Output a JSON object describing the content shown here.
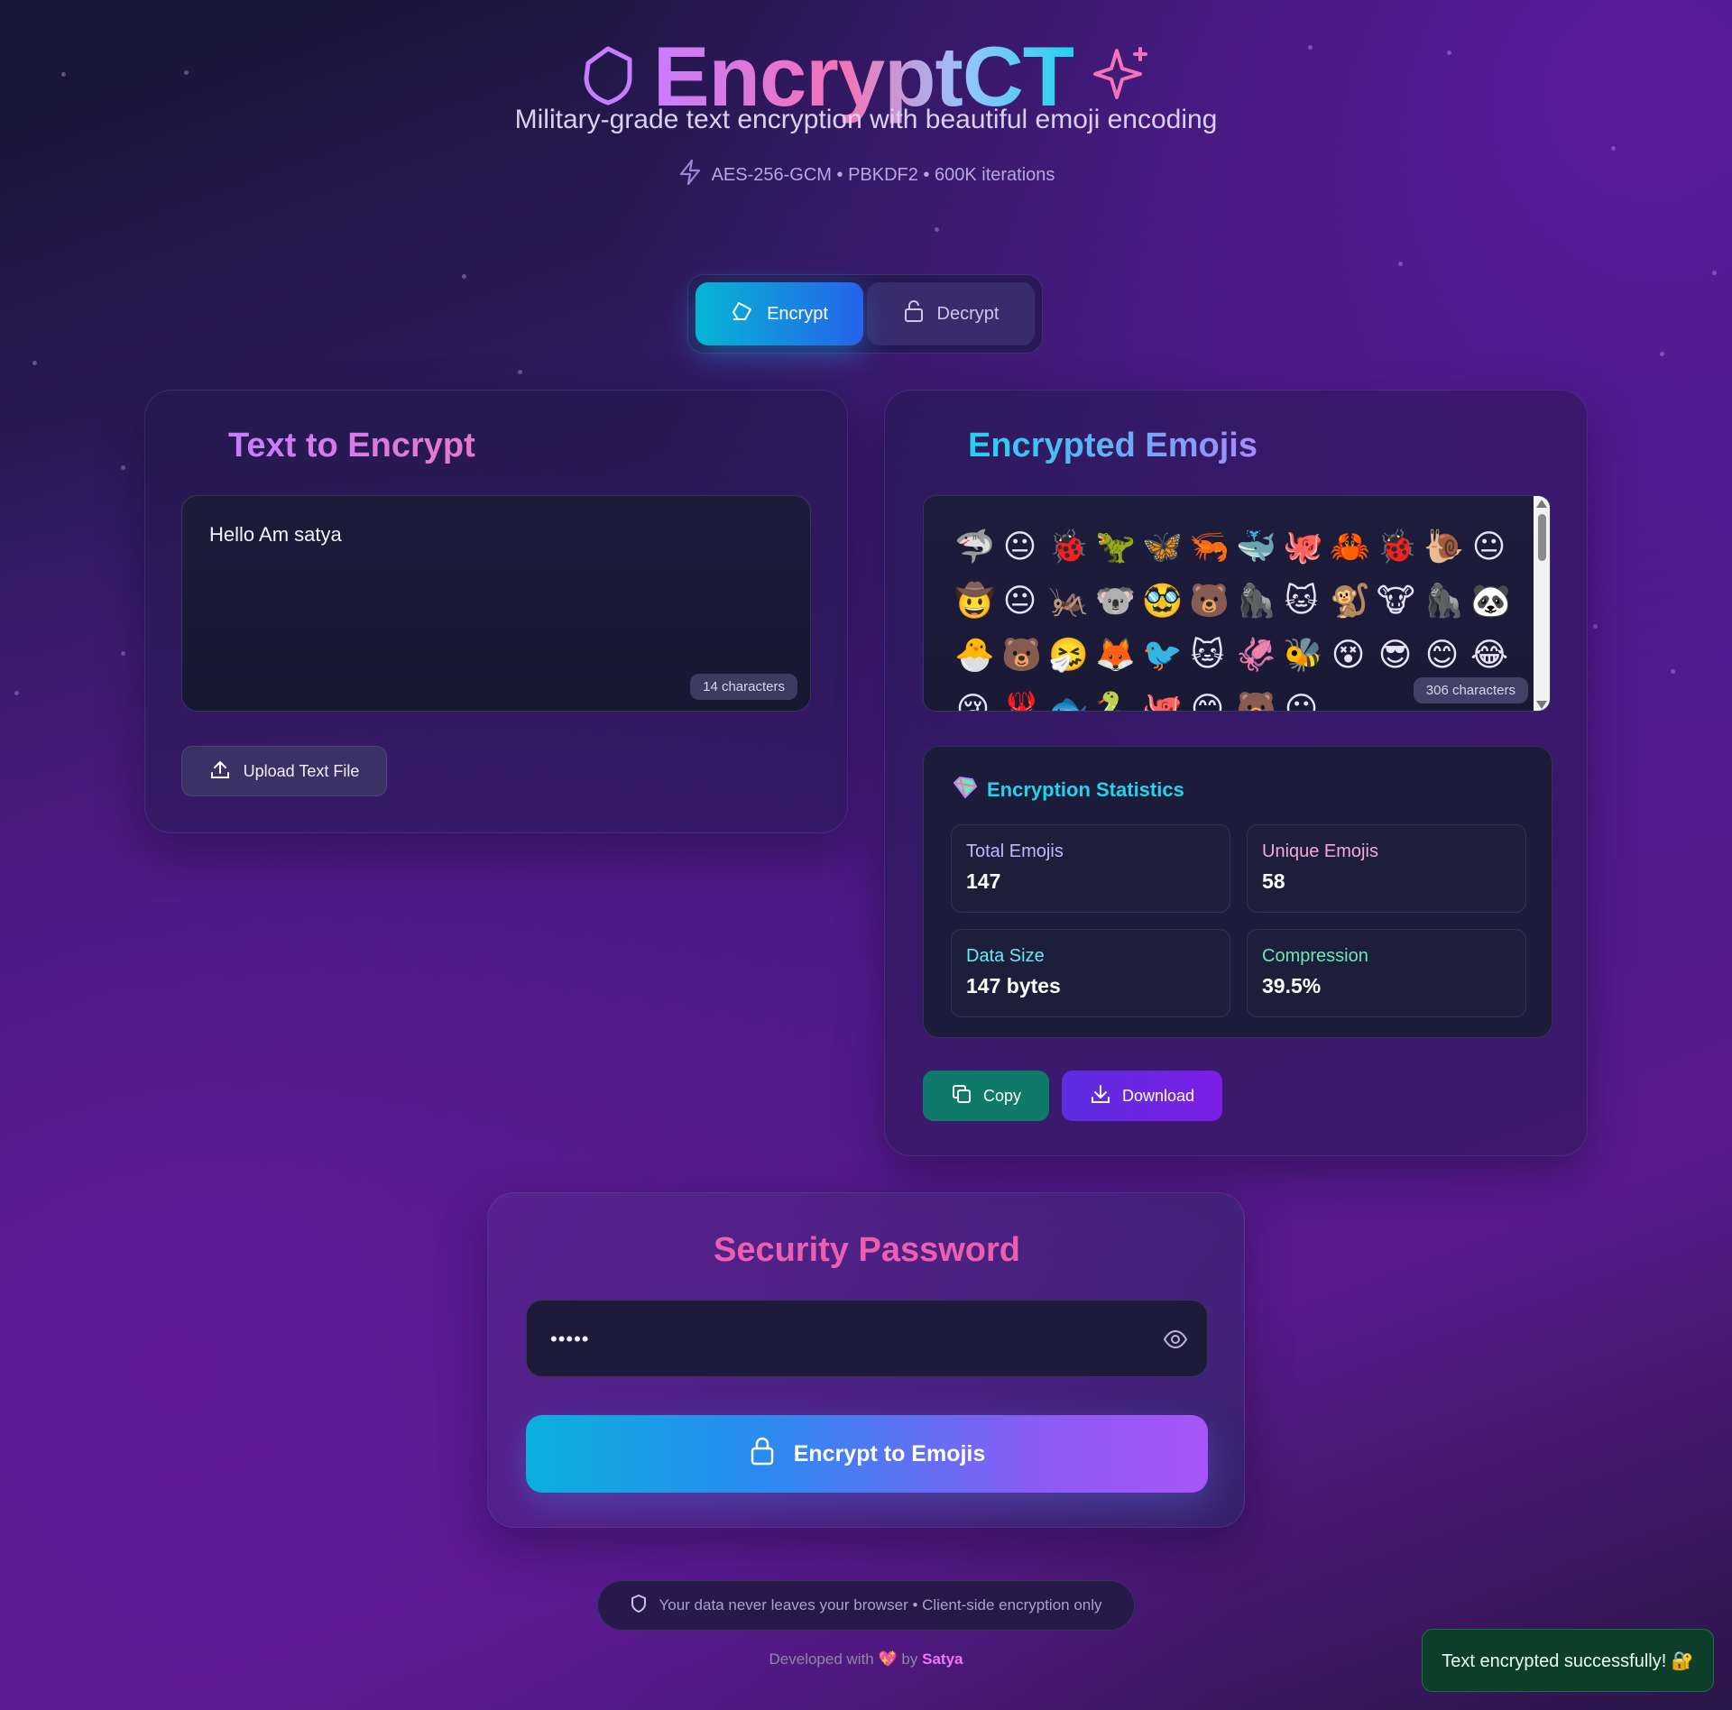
{
  "header": {
    "logo_icon": "shield-outline-icon",
    "title": "EncryptCT",
    "sparkle_icon": "sparkles-icon",
    "subtitle": "Military-grade text encryption with beautiful emoji encoding",
    "specs": "AES-256-GCM • PBKDF2 • 600K iterations",
    "specs_icon": "lightning-icon"
  },
  "mode_toggle": {
    "encrypt_label": "Encrypt",
    "decrypt_label": "Decrypt",
    "active": "Encrypt"
  },
  "input_panel": {
    "title": "Text to Encrypt",
    "text": "Hello Am satya",
    "char_count": "14 characters",
    "upload_label": "Upload Text File"
  },
  "output_panel": {
    "title": "Encrypted Emojis",
    "emojis": [
      "🦈",
      "😐",
      "🐞",
      "🦖",
      "🦋",
      "🦐",
      "🐳",
      "🐙",
      "🦀",
      "🐞",
      "🐌",
      "😐",
      "🤠",
      "😐",
      "🦗",
      "🐨",
      "🥸",
      "🐻",
      "🦍",
      "🐱",
      "🐒",
      "🐮",
      "🦍",
      "🐼",
      "🐣",
      "🐻",
      "🤧",
      "🦊",
      "🐦",
      "🐱",
      "🦑",
      "🐝",
      "😵",
      "😎",
      "😊",
      "😂",
      "😢",
      "🦞",
      "🐟",
      "🐍",
      "🐙",
      "😊",
      "🐻",
      "😐"
    ],
    "char_count": "306 characters",
    "stats": {
      "title": "Encryption Statistics",
      "total_label": "Total Emojis",
      "total_value": "147",
      "unique_label": "Unique Emojis",
      "unique_value": "58",
      "size_label": "Data Size",
      "size_value": "147 bytes",
      "compression_label": "Compression",
      "compression_value": "39.5%"
    },
    "copy_label": "Copy",
    "download_label": "Download"
  },
  "password": {
    "title": "Security Password",
    "value": "•••••",
    "encrypt_button": "Encrypt to Emojis"
  },
  "footer": {
    "privacy_note": "Your data never leaves your browser • Client-side encryption only",
    "credit_prefix": "Developed with",
    "credit_heart": "💖",
    "credit_by": "by",
    "author": "Satya"
  },
  "toast": {
    "message": "Text encrypted successfully! 🔐"
  },
  "colors": {
    "accent_cyan": "#22d3ee",
    "accent_purple": "#a855f7",
    "accent_pink": "#ec5fb0",
    "success_green": "#0f3d2c"
  }
}
